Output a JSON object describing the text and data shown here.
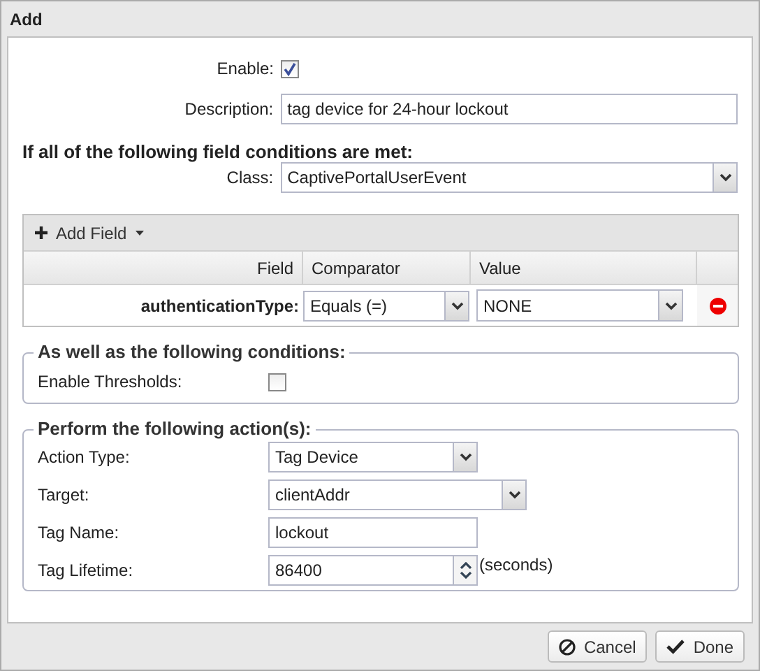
{
  "dialog": {
    "title": "Add"
  },
  "enable": {
    "label": "Enable:",
    "checked": true
  },
  "description": {
    "label": "Description:",
    "value": "tag device for 24-hour lockout"
  },
  "conditions_heading": "If all of the following field conditions are met:",
  "class": {
    "label": "Class:",
    "value": "CaptivePortalUserEvent"
  },
  "conditions_table": {
    "add_button": "Add Field",
    "columns": [
      "Field",
      "Comparator",
      "Value"
    ],
    "rows": [
      {
        "field": "authenticationType:",
        "comparator": "Equals (=)",
        "value": "NONE"
      }
    ]
  },
  "thresholds": {
    "legend": "As well as the following conditions:",
    "label": "Enable Thresholds:",
    "checked": false
  },
  "actions": {
    "legend": "Perform the following action(s):",
    "rows": [
      {
        "kind": "select",
        "label": "Action Type:",
        "value": "Tag Device",
        "wide": false
      },
      {
        "kind": "select",
        "label": "Target:",
        "value": "clientAddr",
        "wide": true
      },
      {
        "kind": "text",
        "label": "Tag Name:",
        "value": "lockout"
      },
      {
        "kind": "spinner",
        "label": "Tag Lifetime:",
        "value": "86400",
        "unit": "(seconds)"
      }
    ]
  },
  "buttons": [
    {
      "kind": "cancel",
      "label": "Cancel"
    },
    {
      "kind": "done",
      "label": "Done"
    }
  ]
}
